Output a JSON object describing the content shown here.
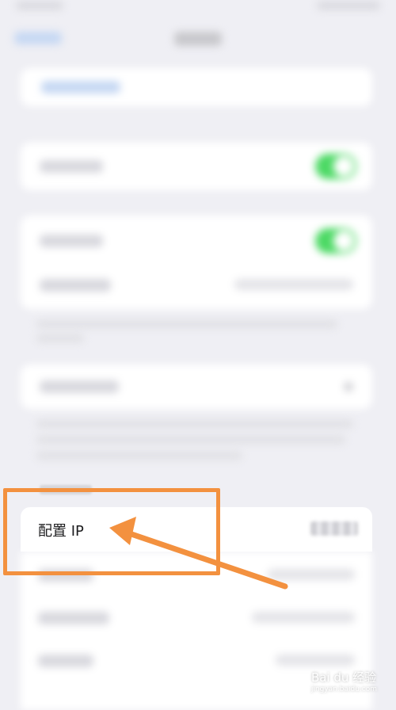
{
  "ip_section": {
    "configure_ip_label": "配置 IP"
  },
  "colors": {
    "highlight": "#f3913f",
    "toggle_on": "#4cd964",
    "background": "#efeff4"
  },
  "watermark": {
    "text": "Bai du 经验",
    "sub": "jingyan.baidu.com"
  }
}
